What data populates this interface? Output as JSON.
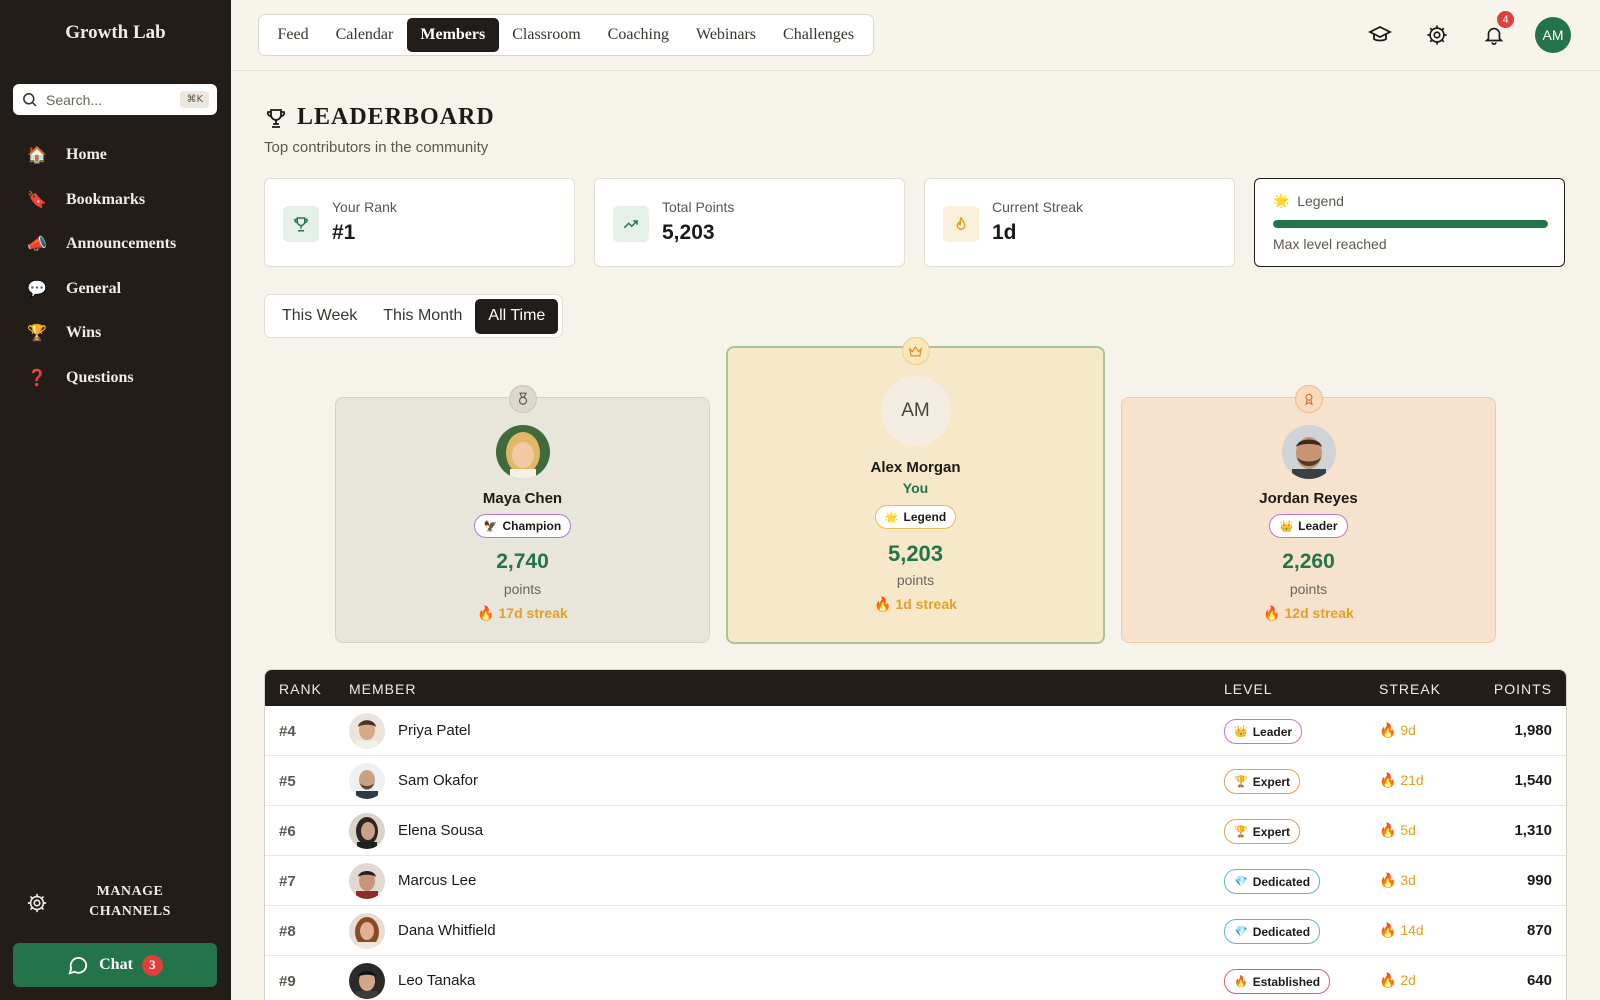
{
  "app": {
    "name": "Growth Lab"
  },
  "sidebar": {
    "search_placeholder": "Search...",
    "search_shortcut": "⌘K",
    "items": [
      {
        "label": "Home",
        "icon": "🏠"
      },
      {
        "label": "Bookmarks",
        "icon": "🔖"
      },
      {
        "label": "Announcements",
        "icon": "📣"
      },
      {
        "label": "General",
        "icon": "💬"
      },
      {
        "label": "Wins",
        "icon": "🏆"
      },
      {
        "label": "Questions",
        "icon": "❓"
      }
    ],
    "manage_line1": "MANAGE",
    "manage_line2": "CHANNELS",
    "chat_label": "Chat",
    "chat_count": "3"
  },
  "topnav": {
    "tabs": [
      "Feed",
      "Calendar",
      "Members",
      "Classroom",
      "Coaching",
      "Webinars",
      "Challenges"
    ],
    "active_tab": "Members",
    "notification_count": "4",
    "user_initials": "AM"
  },
  "page": {
    "title": "LEADERBOARD",
    "subtitle": "Top contributors in the community"
  },
  "stats": {
    "rank_label": "Your Rank",
    "rank_value": "#1",
    "points_label": "Total Points",
    "points_value": "5,203",
    "streak_label": "Current Streak",
    "streak_value": "1d",
    "legend_label": "Legend",
    "legend_sub": "Max level reached",
    "legend_progress": 1.0
  },
  "period": {
    "options": [
      "This Week",
      "This Month",
      "All Time"
    ],
    "active": "All Time"
  },
  "podium": {
    "second": {
      "name": "Maya Chen",
      "badge": "Champion",
      "badge_icon": "🦅",
      "points": "2,740",
      "points_label": "points",
      "streak": "17d streak"
    },
    "first": {
      "initials": "AM",
      "name": "Alex Morgan",
      "you": "You",
      "badge": "Legend",
      "badge_icon": "🌟",
      "points": "5,203",
      "points_label": "points",
      "streak": "1d streak"
    },
    "third": {
      "name": "Jordan Reyes",
      "badge": "Leader",
      "badge_icon": "👑",
      "points": "2,260",
      "points_label": "points",
      "streak": "12d streak"
    }
  },
  "table": {
    "headers": {
      "rank": "RANK",
      "member": "MEMBER",
      "level": "LEVEL",
      "streak": "STREAK",
      "points": "POINTS"
    },
    "rows": [
      {
        "rank": "#4",
        "name": "Priya Patel",
        "level": "Leader",
        "level_icon": "👑",
        "streak": "9d",
        "points": "1,980"
      },
      {
        "rank": "#5",
        "name": "Sam Okafor",
        "level": "Expert",
        "level_icon": "🏆",
        "streak": "21d",
        "points": "1,540"
      },
      {
        "rank": "#6",
        "name": "Elena Sousa",
        "level": "Expert",
        "level_icon": "🏆",
        "streak": "5d",
        "points": "1,310"
      },
      {
        "rank": "#7",
        "name": "Marcus Lee",
        "level": "Dedicated",
        "level_icon": "💎",
        "streak": "3d",
        "points": "990"
      },
      {
        "rank": "#8",
        "name": "Dana Whitfield",
        "level": "Dedicated",
        "level_icon": "💎",
        "streak": "14d",
        "points": "870"
      },
      {
        "rank": "#9",
        "name": "Leo Tanaka",
        "level": "Established",
        "level_icon": "🔥",
        "streak": "2d",
        "points": "640"
      }
    ]
  },
  "colors": {
    "sidebar_bg": "#221d18",
    "accent_green": "#23744a",
    "streak_orange": "#e0a126",
    "badge_red": "#e0403a"
  }
}
